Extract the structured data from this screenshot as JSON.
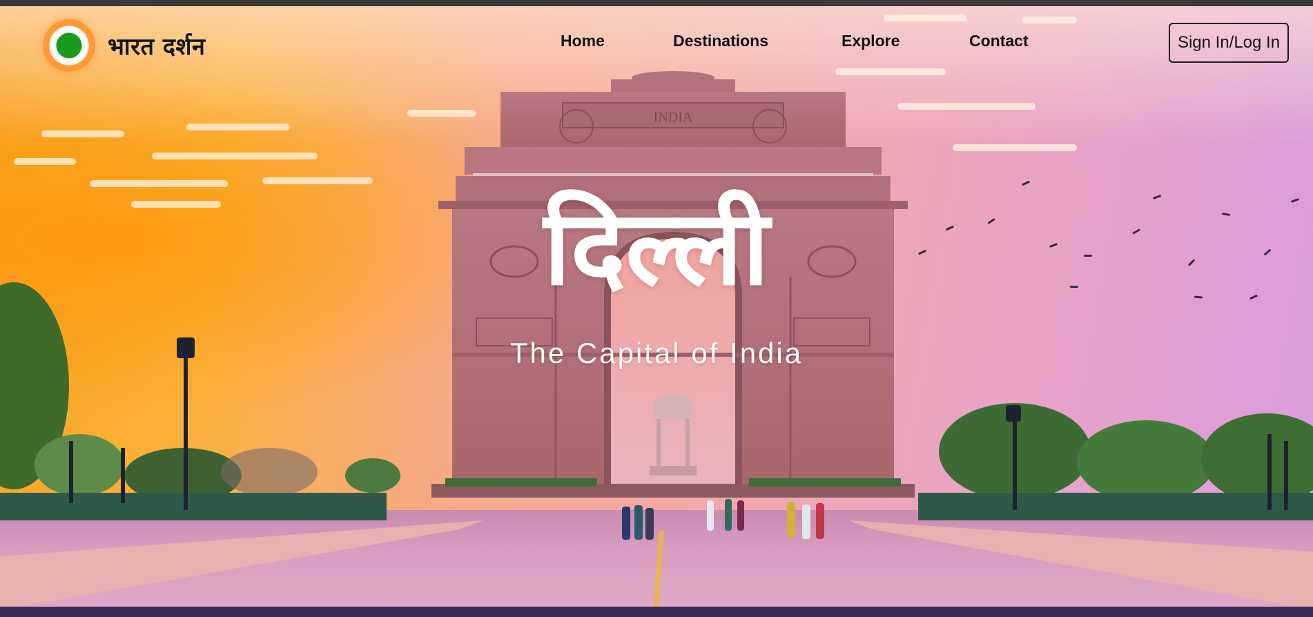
{
  "site": {
    "brand_name": "भारत दर्शन",
    "logo": "india-flag-roundel-icon"
  },
  "nav": {
    "items": [
      {
        "label": "Home"
      },
      {
        "label": "Destinations"
      },
      {
        "label": "Explore"
      },
      {
        "label": "Contact"
      }
    ],
    "signin_label": "Sign In/Log In"
  },
  "hero": {
    "title": "दिल्ली",
    "subtitle": "The Capital of India",
    "image": "india-gate-sunset-photo",
    "inscription": "INDIA"
  },
  "colors": {
    "sky_orange": "#f7a21e",
    "sky_pink": "#e9a4c4",
    "sky_violet": "#d89be0",
    "gate_sandstone": "#b87a7e",
    "text_dark": "#111111",
    "text_light": "#ffffff",
    "logo_green": "#1a9a1a",
    "logo_saffron": "#ff9933"
  }
}
